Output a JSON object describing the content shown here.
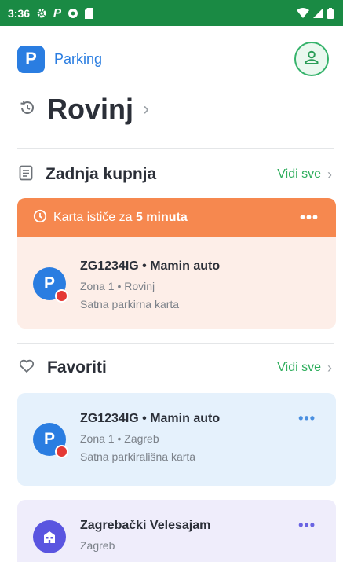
{
  "status_bar": {
    "time": "3:36",
    "icons": [
      "gear-icon",
      "parking-p-icon",
      "shield-icon",
      "sim-icon"
    ],
    "right_icons": [
      "wifi-icon",
      "signal-icon",
      "battery-icon"
    ]
  },
  "header": {
    "logo_letter": "P",
    "app_name": "Parking",
    "profile_icon": "user-icon"
  },
  "city": {
    "name": "Rovinj",
    "history_icon": "history-icon"
  },
  "recent": {
    "title": "Zadnja kupnja",
    "see_all": "Vidi sve",
    "alert": {
      "prefix": "Karta ističe za ",
      "time": "5 minuta"
    },
    "ticket": {
      "avatar_letter": "P",
      "title": "ZG1234IG • Mamin auto",
      "zone": "Zona 1 • Rovinj",
      "type": "Satna parkirna karta"
    }
  },
  "favorites": {
    "title": "Favoriti",
    "see_all": "Vidi sve",
    "items": [
      {
        "avatar_letter": "P",
        "title": "ZG1234IG • Mamin auto",
        "zone": "Zona 1 • Zagreb",
        "type": "Satna parkirališna karta"
      },
      {
        "title": "Zagrebački Velesajam",
        "city": "Zagreb"
      }
    ]
  },
  "colors": {
    "status_bar": "#1a8a44",
    "brand_blue": "#2a7de1",
    "accent_green": "#2fae5d",
    "alert_orange": "#f6884f",
    "alert_bg": "#fdeee8",
    "fav_bg": "#e5f1fc",
    "place_bg": "#efedfb",
    "place_icon": "#5a55e0"
  }
}
